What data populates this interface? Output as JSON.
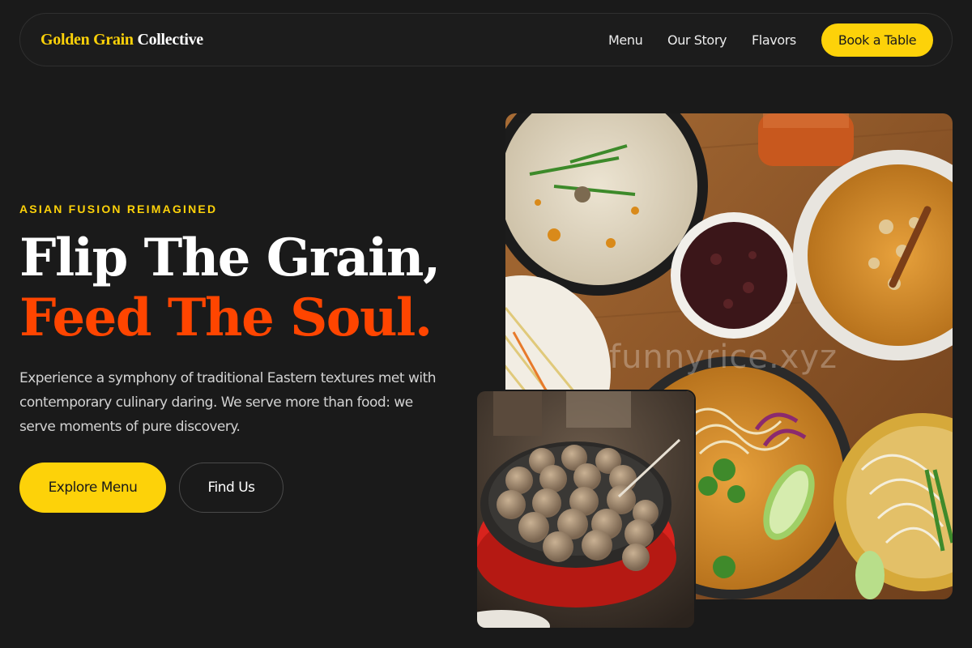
{
  "brand": {
    "part1": "Golden Grain",
    "part2": "Collective"
  },
  "nav": {
    "items": [
      "Menu",
      "Our Story",
      "Flavors"
    ],
    "cta": "Book a Table"
  },
  "hero": {
    "eyebrow": "ASIAN FUSION REIMAGINED",
    "headline_line1": "Flip The Grain,",
    "headline_line2": "Feed The Soul.",
    "lead": "Experience a symphony of traditional Eastern textures met with contemporary culinary daring. We serve more than food: we serve moments of pure discovery.",
    "primary_button": "Explore Menu",
    "secondary_button": "Find Us"
  },
  "images": {
    "main_watermark": "funnyrice.xyz",
    "main_alt": "Assorted Asian dishes: coconut soup, purple rice, curry, noodles on a wooden table",
    "inset_alt": "Takoyaki balls cooking in a red electric griddle"
  },
  "colors": {
    "background": "#1a1a1a",
    "accent_gold": "#fdd209",
    "accent_orange": "#ff4500"
  }
}
